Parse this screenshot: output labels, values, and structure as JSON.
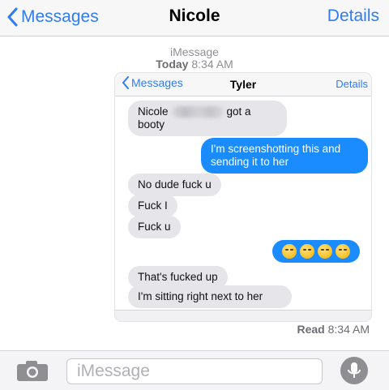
{
  "navbar": {
    "back_label": "Messages",
    "title": "Nicole",
    "details_label": "Details"
  },
  "meta": {
    "service": "iMessage",
    "timestamp_day": "Today",
    "timestamp_time": "8:34 AM"
  },
  "screenshot": {
    "nav": {
      "back_label": "Messages",
      "title": "Tyler",
      "details_label": "Details"
    },
    "messages": [
      {
        "from": "in",
        "text_before": "Nicole",
        "text_after": "got a",
        "text_line2": "booty"
      },
      {
        "from": "out",
        "text": "I'm screenshotting this and sending it to her"
      },
      {
        "from": "in",
        "text": "No dude fuck u"
      },
      {
        "from": "in",
        "text": "Fuck I"
      },
      {
        "from": "in",
        "text": "Fuck u"
      },
      {
        "from": "out",
        "emoji": "😂😂😂😂"
      },
      {
        "from": "in",
        "text": "That's fucked up"
      },
      {
        "from": "in",
        "text": "I'm sitting right next to her"
      }
    ]
  },
  "status": {
    "read_label": "Read",
    "read_time": "8:34 AM"
  },
  "composer": {
    "placeholder": "iMessage",
    "value": ""
  },
  "colors": {
    "accent": "#2f7cf6",
    "outgoing_bubble": "#1a8cff",
    "incoming_bubble": "#e5e5ea"
  },
  "icons": {
    "back": "chevron-left-icon",
    "camera": "camera-icon",
    "mic": "microphone-icon"
  }
}
